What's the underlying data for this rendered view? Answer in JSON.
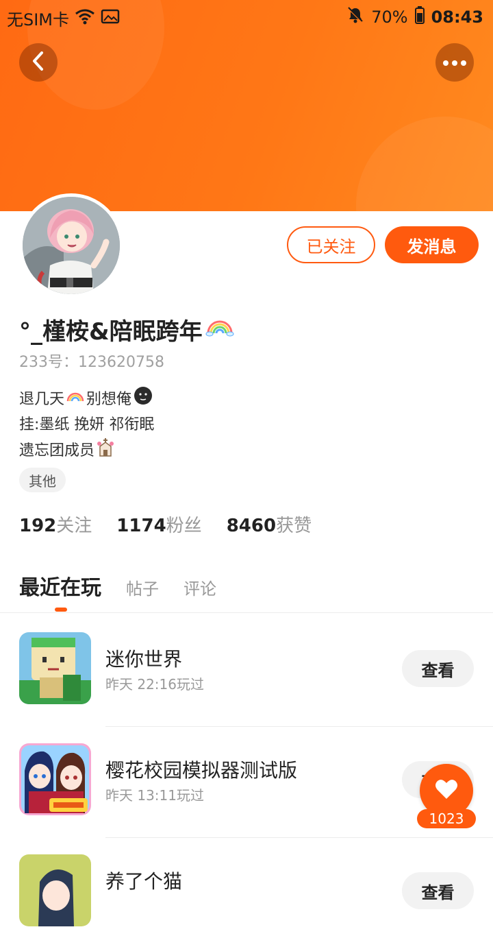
{
  "statusbar": {
    "carrier": "无SIM卡",
    "battery": "70%",
    "time": "08:43"
  },
  "profile": {
    "nickname": "°_槿桉&陪眠跨年",
    "uid": "233号：123620758",
    "bio": {
      "line1_a": "退几天",
      "line1_b": "别想俺",
      "line2": "挂:墨纸 挽妍 祁衔眠",
      "line3": "遗忘团成员"
    },
    "tag": "其他",
    "following_count": "192",
    "following_label": "关注",
    "fans_count": "1174",
    "fans_label": "粉丝",
    "likes_count": "8460",
    "likes_label": "获赞"
  },
  "actions": {
    "followed_label": "已关注",
    "message_label": "发消息"
  },
  "tabs": [
    {
      "label": "最近在玩"
    },
    {
      "label": "帖子"
    },
    {
      "label": "评论"
    }
  ],
  "games": [
    {
      "name": "迷你世界",
      "played": "昨天 22:16玩过",
      "button": "查看"
    },
    {
      "name": "樱花校园模拟器测试版",
      "played": "昨天 13:11玩过",
      "button": "查看"
    },
    {
      "name": "养了个猫",
      "played": "",
      "button": "查看"
    }
  ],
  "like_fab": {
    "count": "1023"
  },
  "colors": {
    "accent": "#ff5a0e",
    "header": "#ff7716"
  }
}
